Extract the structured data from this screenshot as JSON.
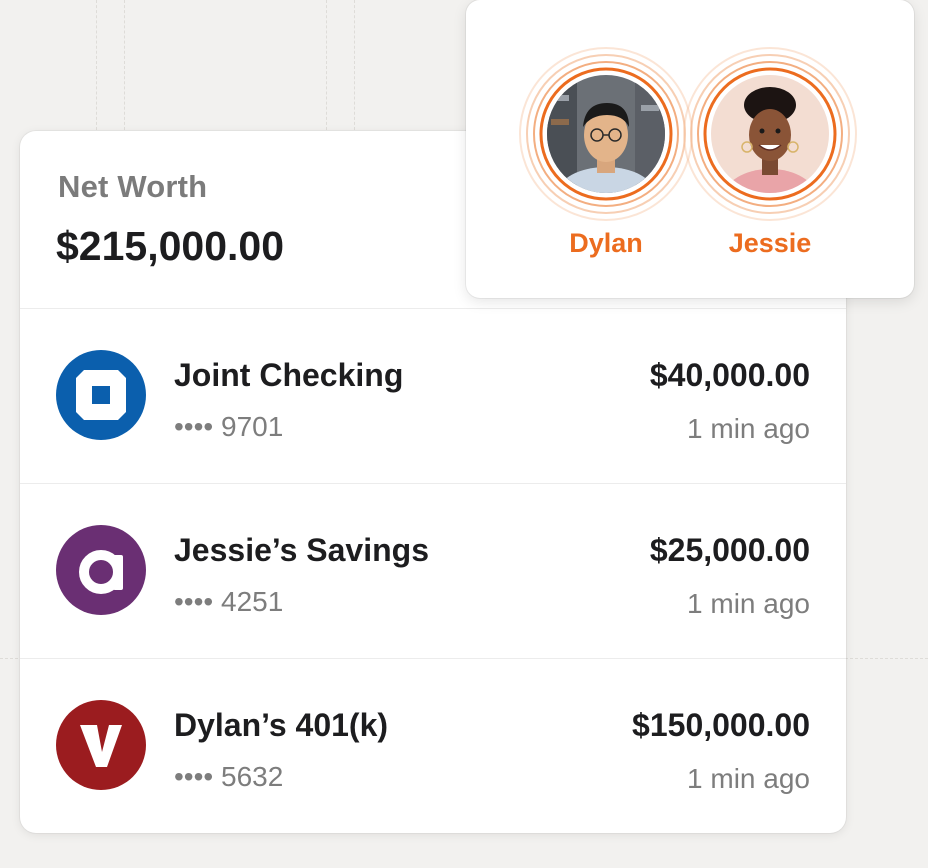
{
  "net_worth": {
    "label": "Net Worth",
    "value": "$215,000.00"
  },
  "people": [
    {
      "name": "Dylan"
    },
    {
      "name": "Jessie"
    }
  ],
  "accounts": [
    {
      "name": "Joint Checking",
      "masked_number": "•••• 9701",
      "amount": "$40,000.00",
      "updated": "1 min ago",
      "logo_icon": "chase-logo-icon",
      "logo_color": "#0b5fad"
    },
    {
      "name": "Jessie’s Savings",
      "masked_number": "•••• 4251",
      "amount": "$25,000.00",
      "updated": "1 min ago",
      "logo_icon": "ally-logo-icon",
      "logo_color": "#6a2f73"
    },
    {
      "name": "Dylan’s 401(k)",
      "masked_number": "•••• 5632",
      "amount": "$150,000.00",
      "updated": "1 min ago",
      "logo_icon": "vanguard-logo-icon",
      "logo_color": "#9b1c1f"
    }
  ],
  "colors": {
    "accent_orange": "#ec6c1f",
    "text_primary": "#1d1d1f",
    "text_secondary": "#7d7d7d",
    "background": "#f2f1ef"
  }
}
